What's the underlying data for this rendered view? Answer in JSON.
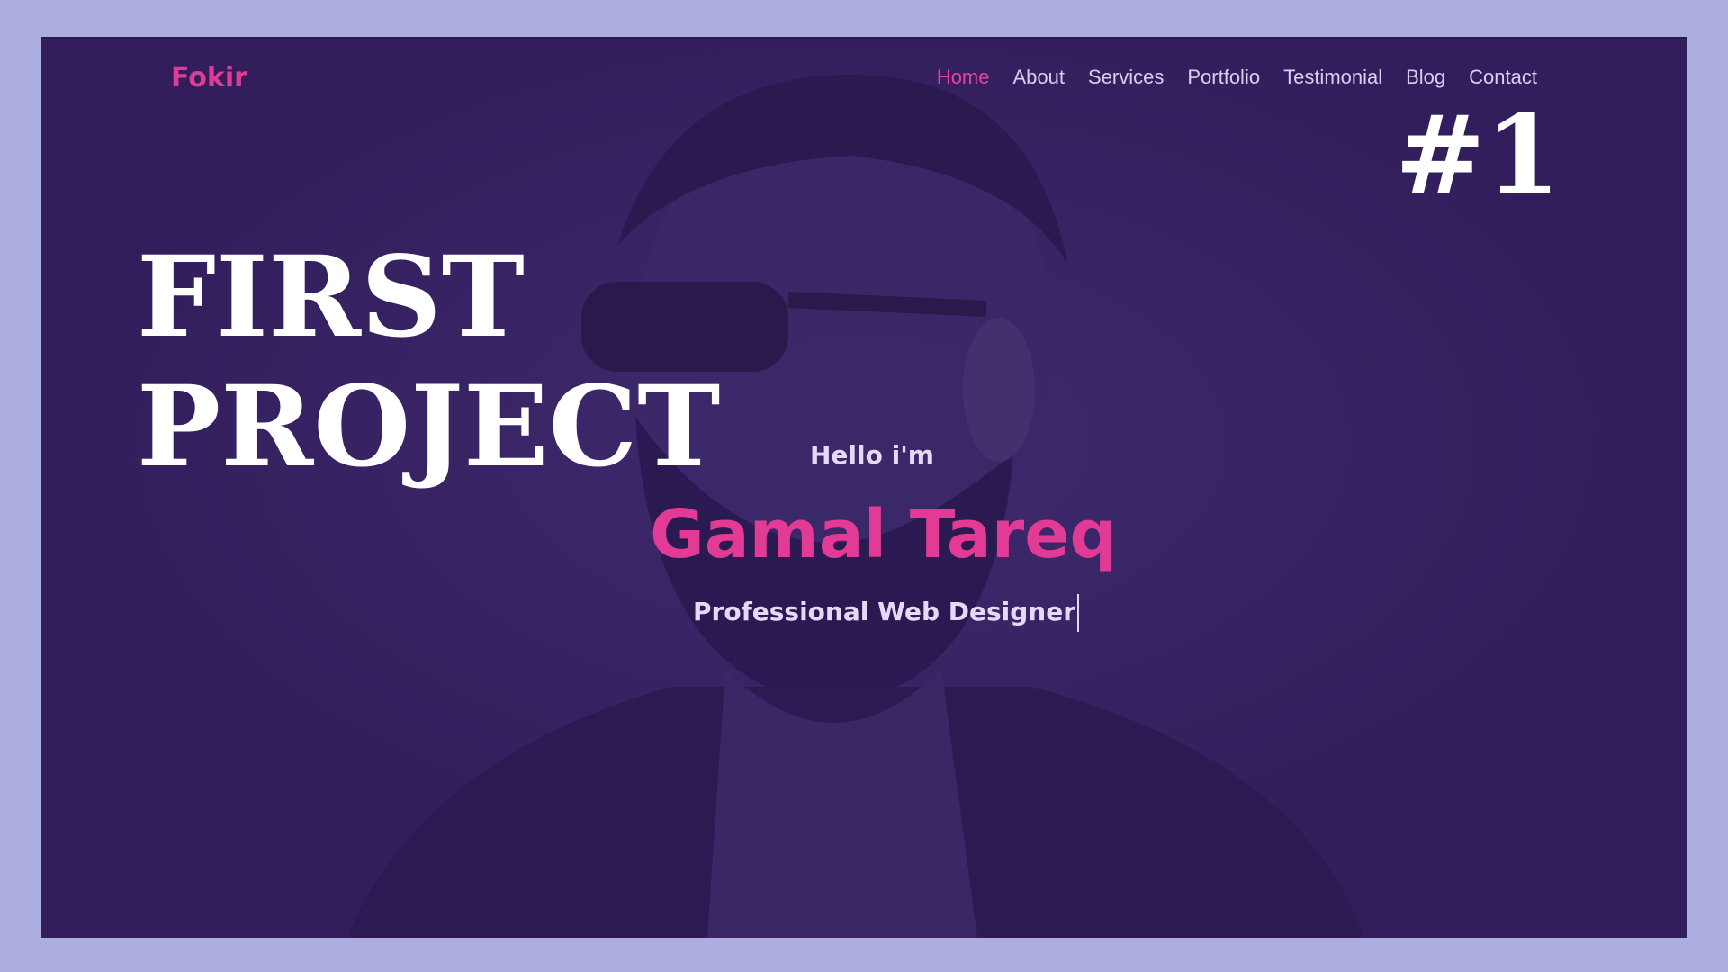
{
  "nav": {
    "logo": "Fokir",
    "items": [
      {
        "label": "Home",
        "active": true
      },
      {
        "label": "About",
        "active": false
      },
      {
        "label": "Services",
        "active": false
      },
      {
        "label": "Portfolio",
        "active": false
      },
      {
        "label": "Testimonial",
        "active": false
      },
      {
        "label": "Blog",
        "active": false
      },
      {
        "label": "Contact",
        "active": false
      }
    ]
  },
  "overlay": {
    "badge": "#1",
    "title_line1": "FIRST",
    "title_line2": "PROJECT"
  },
  "hero": {
    "greeting": "Hello i'm",
    "name": "Gamal Tareq",
    "role": "Professional Web  Designer"
  },
  "colors": {
    "accent": "#e13b96",
    "background": "#321e5c",
    "outer": "#adaee0"
  }
}
